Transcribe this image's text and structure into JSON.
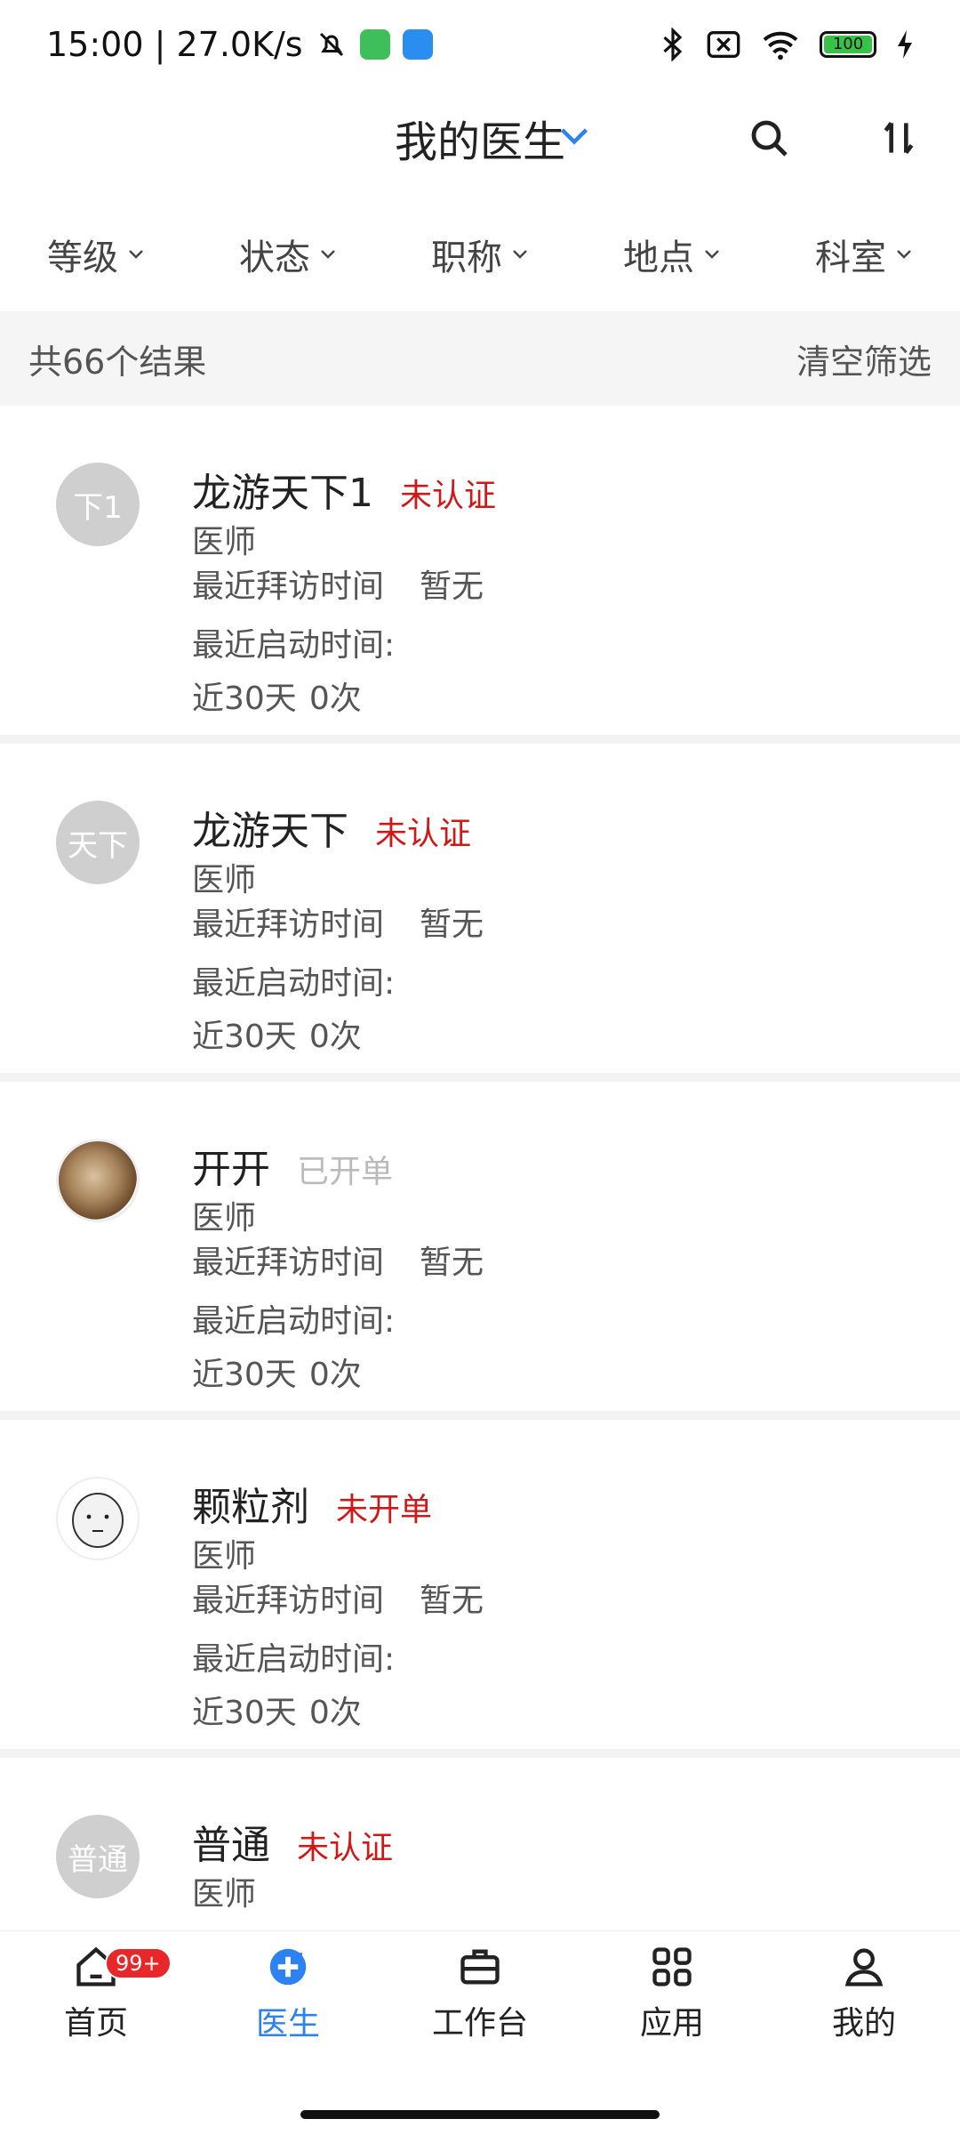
{
  "status_bar": {
    "time_speed": "15:00 | 27.0K/s",
    "battery": "100",
    "icons": [
      "mute-bell-icon",
      "app-green-icon",
      "app-blue-icon",
      "bluetooth-icon",
      "sim-x-icon",
      "wifi-icon",
      "battery-icon",
      "charging-icon"
    ]
  },
  "header": {
    "title": "我的医生",
    "icons": [
      "chevron-down-icon",
      "search-icon",
      "sort-icon"
    ]
  },
  "filters": [
    {
      "label": "等级"
    },
    {
      "label": "状态"
    },
    {
      "label": "职称"
    },
    {
      "label": "地点"
    },
    {
      "label": "科室"
    }
  ],
  "results": {
    "count_text": "共66个结果",
    "clear_label": "清空筛选"
  },
  "doctors": [
    {
      "avatar_text": "下1",
      "name": "龙游天下1",
      "status": "未认证",
      "role": "医师",
      "visit_label": "最近拜访时间",
      "visit_value": "暂无",
      "launch_label": "最近启动时间:",
      "period": "近30天",
      "times": "0次"
    },
    {
      "avatar_text": "天下",
      "name": "龙游天下",
      "status": "未认证",
      "role": "医师",
      "visit_label": "最近拜访时间",
      "visit_value": "暂无",
      "launch_label": "最近启动时间:",
      "period": "近30天",
      "times": "0次"
    },
    {
      "avatar_text": "",
      "name": "开开",
      "status": "已开单",
      "role": "医师",
      "visit_label": "最近拜访时间",
      "visit_value": "暂无",
      "launch_label": "最近启动时间:",
      "period": "近30天",
      "times": "0次"
    },
    {
      "avatar_text": "",
      "name": "颗粒剂",
      "status": "未开单",
      "role": "医师",
      "visit_label": "最近拜访时间",
      "visit_value": "暂无",
      "launch_label": "最近启动时间:",
      "period": "近30天",
      "times": "0次"
    },
    {
      "avatar_text": "普通",
      "name": "普通",
      "status": "未认证",
      "role": "医师",
      "visit_label": "",
      "visit_value": "",
      "launch_label": "",
      "period": "",
      "times": ""
    }
  ],
  "colors": {
    "accent": "#2c82f0",
    "status_red": "#d01818",
    "status_muted": "#bbbbbb",
    "badge": "#e8272b"
  },
  "bottom_nav": [
    {
      "label": "首页",
      "icon": "home-icon",
      "badge": "99+"
    },
    {
      "label": "医生",
      "icon": "doctor-plus-icon",
      "active": true
    },
    {
      "label": "工作台",
      "icon": "briefcase-icon"
    },
    {
      "label": "应用",
      "icon": "grid-apps-icon"
    },
    {
      "label": "我的",
      "icon": "user-icon"
    }
  ]
}
